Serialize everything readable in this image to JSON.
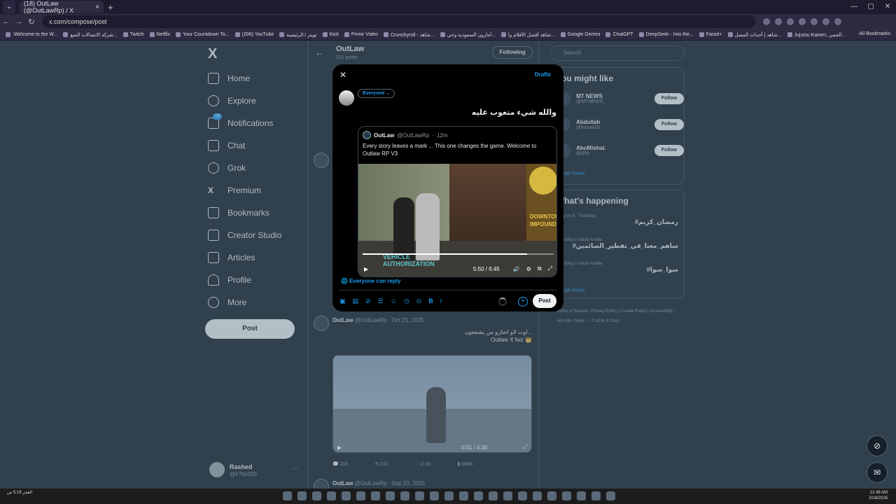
{
  "browser": {
    "tab_title": "(18) OutLaw (@OutLawRp) / X",
    "url": "x.com/compose/post",
    "bookmarks": [
      ":Welcome to the W...",
      "شركة الاتصالات السع...",
      "Twitch",
      "Netflix",
      "Your Countdown To...",
      "(206) YouTube",
      "تويتر / الرئيسية",
      "Kick",
      "Prime Video",
      "Crunchyroll - شاهد...",
      "أمازون السعودية وحي...",
      "شاهد أفضل الأفلام وا...",
      "Google Gemini",
      "ChatGPT",
      "DeepSeek - Into the...",
      "Faisel+",
      "شاهد | أحداث المسل...",
      "Jujutsu Kaisen, الجمي..."
    ],
    "all_bookmarks": "All Bookmarks"
  },
  "sidebar": {
    "logo": "X",
    "items": [
      {
        "label": "Home",
        "icon": "home-icon"
      },
      {
        "label": "Explore",
        "icon": "search-icon"
      },
      {
        "label": "Notifications",
        "icon": "bell-icon",
        "badge": "18"
      },
      {
        "label": "Chat",
        "icon": "mail-icon"
      },
      {
        "label": "Grok",
        "icon": "grok-icon"
      },
      {
        "label": "Premium",
        "icon": "x-icon"
      },
      {
        "label": "Bookmarks",
        "icon": "bookmark-icon"
      },
      {
        "label": "Creator Studio",
        "icon": "studio-icon"
      },
      {
        "label": "Articles",
        "icon": "article-icon"
      },
      {
        "label": "Profile",
        "icon": "person-icon"
      },
      {
        "label": "More",
        "icon": "more-icon"
      }
    ],
    "post_label": "Post",
    "user": {
      "name": "Rashed",
      "handle": "@F7bx555"
    }
  },
  "profile": {
    "name": "OutLaw",
    "posts": "231 posts",
    "follow_state": "Following"
  },
  "tweets": [
    {
      "name": "OutLaw",
      "handle": "@OutLawRp",
      "date": "Oct 21, 2025",
      "text_line1": "اوت لاو احتارو من يشجعون ..",
      "text_line2": "Outlaw X fwz 👑",
      "video_time": "0:01 / 4:30",
      "replies": "205",
      "reposts": "232",
      "likes": "2.1K",
      "views": "680K"
    },
    {
      "name": "OutLaw",
      "handle": "@OutLawRp",
      "date": "Sep 23, 2025"
    }
  ],
  "right": {
    "search_placeholder": "Search",
    "wtf_title": "You might like",
    "suggest": [
      {
        "name": "MT NEWS",
        "handle": "@MTNEWS_",
        "btn": "Follow"
      },
      {
        "name": "Abdullah",
        "handle": "@lmnaa16",
        "btn": "Follow"
      },
      {
        "name": "AboMishal.",
        "handle": "@t2ld",
        "btn": "Follow"
      }
    ],
    "show_more": "Show more",
    "happening_title": "What's happening",
    "trends": [
      {
        "ctx": "Only on X · Trending",
        "tag": "#رمضان_كريم"
      },
      {
        "ctx": "Trending in Saudi Arabia",
        "tag": "#ساهم_معنا_في_تفطير_الصائمين"
      },
      {
        "ctx": "Trending in Saudi Arabia",
        "tag": "#سوا_سوا"
      }
    ],
    "footer": "Terms of Service | Privacy Policy | Cookie Policy | Accessibility | Ads info | More ··· © 2026 X Corp."
  },
  "modal": {
    "drafts": "Drafts",
    "audience": "Everyone",
    "post_text": "والله شيء متعوب عليه",
    "quote": {
      "name": "OutLaw",
      "handle": "@OutLawRp",
      "time": "12m",
      "text": "Every story leaves a mark ... This one changes the game. Welcome to Outlaw RP V3",
      "video_time": "5:50 / 6:45",
      "progress": 0.86,
      "overlay1": "DOWNTOWN IMPOUND",
      "overlay2": "VEHICLE AUTHORIZATION"
    },
    "reply_setting": "Everyone can reply",
    "post_label": "Post"
  },
  "taskbar": {
    "left": "الفجر 5:19 ص",
    "time": "12:48 AM",
    "date": "2/18/2026"
  }
}
